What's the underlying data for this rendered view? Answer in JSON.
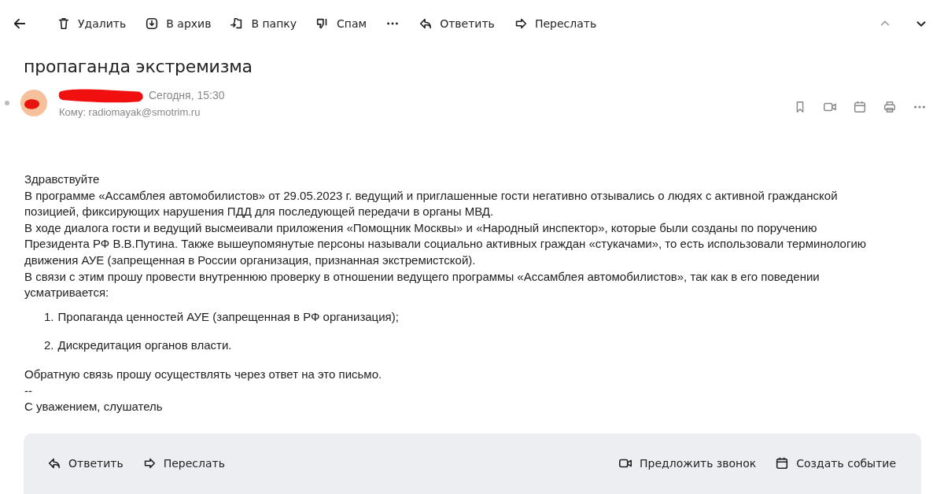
{
  "toolbar": {
    "actions": [
      {
        "kind": "delete",
        "label": "Удалить"
      },
      {
        "kind": "archive",
        "label": "В архив"
      },
      {
        "kind": "folder",
        "label": "В папку"
      },
      {
        "kind": "spam",
        "label": "Спам"
      },
      {
        "kind": "more"
      },
      {
        "kind": "reply",
        "label": "Ответить"
      },
      {
        "kind": "forward",
        "label": "Переслать"
      }
    ]
  },
  "subject": "пропаганда экстремизма",
  "message": {
    "date": "Сегодня, 15:30",
    "to": "Кому: radiomayak@smotrim.ru",
    "tools": [
      {
        "kind": "bookmark"
      },
      {
        "kind": "video"
      },
      {
        "kind": "calendar"
      },
      {
        "kind": "print"
      },
      {
        "kind": "more"
      }
    ],
    "body": [
      {
        "kind": "text",
        "lines": [
          "Здравствуйте",
          "В программе «Ассамблея автомобилистов» от 29.05.2023 г. ведущий и приглашенные гости негативно отзывались о людях с активной гражданской",
          "позицией, фиксирующих нарушения ПДД для последующей передачи в органы МВД.",
          "В ходе диалога гости и ведущий высмеивали приложения «Помощник Москвы» и «Народный инспектор», которые были созданы по поручению",
          "Президента РФ В.В.Путина. Также вышеупомянутые персоны называли социально активных граждан «стукачами», то есть использовали терминологию",
          "движения АУЕ (запрещенная в России организация, признанная экстремистской).",
          "В связи с этим прошу провести внутреннюю проверку в отношении ведущего программы «Ассамблея автомобилистов», так как в его поведении",
          "усматривается:"
        ]
      },
      {
        "kind": "list",
        "items": [
          "Пропаганда ценностей АУЕ (запрещенная в РФ организация);",
          "Дискредитация органов власти."
        ],
        "numbers": [
          "1.",
          "2."
        ]
      },
      {
        "kind": "text",
        "lines": [
          "Обратную связь прошу осуществлять через ответ на это письмо.",
          "--",
          "С уважением, слушатель"
        ]
      }
    ]
  },
  "footer": {
    "left": [
      {
        "kind": "reply",
        "label": "Ответить"
      },
      {
        "kind": "forward",
        "label": "Переслать"
      }
    ],
    "right": [
      {
        "kind": "video",
        "label": "Предложить звонок"
      },
      {
        "kind": "calendar",
        "label": "Создать событие"
      }
    ]
  }
}
